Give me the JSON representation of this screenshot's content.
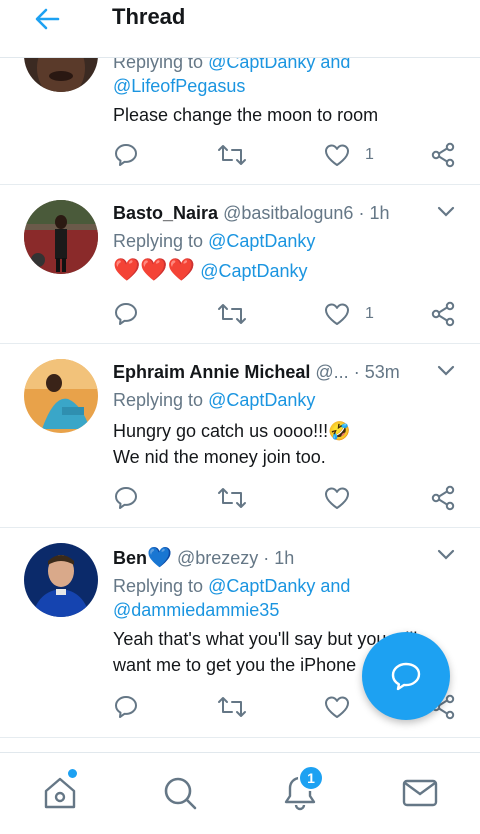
{
  "header": {
    "title": "Thread",
    "accent": "#1da1f2"
  },
  "tweets": [
    {
      "reply_prefix": "Replying to",
      "reply_to": "@CaptDanky and",
      "reply_to_2": "@LifeofPegasus",
      "text": "Please change the moon to room",
      "like_count": "1"
    },
    {
      "name": "Basto_Naira",
      "handle": "@basitbalogun6",
      "sep": "·",
      "time": "1h",
      "reply_prefix": "Replying to",
      "reply_to": "@CaptDanky",
      "hearts": "❤️❤️❤️",
      "mention": "@CaptDanky",
      "like_count": "1"
    },
    {
      "name": "Ephraim Annie Micheal",
      "handle": "@...",
      "sep": "·",
      "time": "53m",
      "reply_prefix": "Replying to",
      "reply_to": "@CaptDanky",
      "text_line1": "Hungry go catch us oooo!!!🤣",
      "text_line2": "We nid the money join too."
    },
    {
      "name": "Ben",
      "verified_icon": "💙",
      "handle": "@brezezy",
      "sep": "·",
      "time": "1h",
      "reply_prefix": "Replying to",
      "reply_to": "@CaptDanky and",
      "reply_to_2": "@dammiedammie35",
      "text_line1": "Yeah that's what you'll say but you still",
      "text_line2": "want me to get you the iPhone"
    }
  ],
  "bottom_nav": {
    "notifications_badge": "1"
  },
  "icons": {
    "back": "arrow-left-icon",
    "reply": "reply-icon",
    "retweet": "retweet-icon",
    "like": "heart-icon",
    "share": "share-icon",
    "compose": "compose-reply-icon",
    "home": "home-icon",
    "search": "search-icon",
    "notifications": "bell-icon",
    "messages": "mail-icon"
  }
}
